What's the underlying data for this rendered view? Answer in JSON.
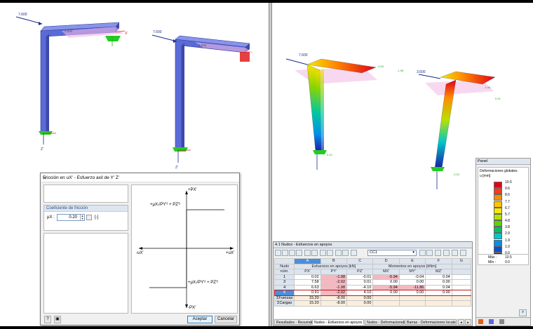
{
  "left_view": {
    "load_label_1": "7.600",
    "load_label_2": "7.600",
    "node_label_1": "2.000",
    "node_label_2": "2.000",
    "axis_z": "Z'",
    "axis_x": "X'"
  },
  "right_view": {
    "load_label_1": "7.600",
    "load_label_2": "3.600",
    "vals": [
      "-5.94",
      "-1.98",
      "4.10",
      "-1.98",
      "0.91",
      "-2.02",
      "7.58",
      "8.35"
    ]
  },
  "dialog": {
    "title": "Fricción en uX' - Esfuerzo axil de Y' Z'",
    "section_title": "Coeficiente de fricción",
    "field_label": "μX :",
    "field_value": "0.20",
    "field_unit": "[-]",
    "graph": {
      "top": "+PX'",
      "bottom": "-PX'",
      "left": "-uX'",
      "right": "+uX'",
      "formula": "+μX√PY'² + PZ'²",
      "formula2": "+μX√PY'² + PZ'²"
    },
    "ok_label": "Aceptar",
    "cancel_label": "Cancelar"
  },
  "panel": {
    "title": "Panel",
    "subtitle1": "Deformaciones globales",
    "subtitle2": "u [mm]",
    "legend": [
      {
        "value": "10.5",
        "color": "#e0001a"
      },
      {
        "value": "9.6",
        "color": "#ff3a1a"
      },
      {
        "value": "8.6",
        "color": "#ff8c00"
      },
      {
        "value": "7.7",
        "color": "#ffc400"
      },
      {
        "value": "6.7",
        "color": "#f2ea00"
      },
      {
        "value": "5.7",
        "color": "#b8e000"
      },
      {
        "value": "4.8",
        "color": "#5cd300"
      },
      {
        "value": "3.8",
        "color": "#00c060"
      },
      {
        "value": "2.9",
        "color": "#00c8c8"
      },
      {
        "value": "1.9",
        "color": "#0090e8"
      },
      {
        "value": "1.0",
        "color": "#0050d8"
      },
      {
        "value": "0.0",
        "color": "#1a1aa8"
      }
    ],
    "max_label": "Máx :",
    "max_value": "10.5",
    "min_label": "Mín :",
    "min_value": "0.0"
  },
  "table": {
    "title": "4.1 Nudos - Esfuerzos en apoyos",
    "loadcase": "CC1",
    "col_letters": [
      "A",
      "B",
      "C",
      "D",
      "E",
      "F",
      "G"
    ],
    "group1": "Esfuerzos en apoyos [kN]",
    "group2": "Momentos en apoyos [kNm]",
    "nudo_h1": "Nudo",
    "nudo_h2": "núm.",
    "cols": [
      "PX'",
      "PY'",
      "PZ'",
      "MX'",
      "MY'",
      "MZ'"
    ],
    "rows": [
      {
        "n": "1",
        "v": [
          "0.02",
          "-1.98",
          "-0.01",
          "-5.94",
          "-0.04",
          "0.04"
        ]
      },
      {
        "n": "3",
        "v": [
          "7.58",
          "-2.02",
          "0.01",
          "0.00",
          "0.00",
          "0.00"
        ]
      },
      {
        "n": "4",
        "v": [
          "6.63",
          "-1.98",
          "-4.10",
          "-5.94",
          "-11.86",
          "0.04"
        ]
      },
      {
        "n": "6",
        "v": [
          "0.91",
          "-2.02",
          "4.10",
          "0.00",
          "0.00",
          "0.00"
        ]
      },
      {
        "n": "ΣFuerzas",
        "v": [
          "15.20",
          "-8.00",
          "0.00",
          "",
          "",
          ""
        ]
      },
      {
        "n": "ΣCargas",
        "v": [
          "15.20",
          "-8.00",
          "0.00",
          "",
          "",
          ""
        ]
      }
    ],
    "tabs": [
      "Resultados - Resumen",
      "Nudos - Esfuerzos en apoyos",
      "Nudos - Deformaciones",
      "Barras - Deformaciones locales"
    ]
  },
  "colors": {
    "member": "#5a6bd8",
    "beam_top": "#4455cc",
    "accent": "#3c7fb1"
  }
}
